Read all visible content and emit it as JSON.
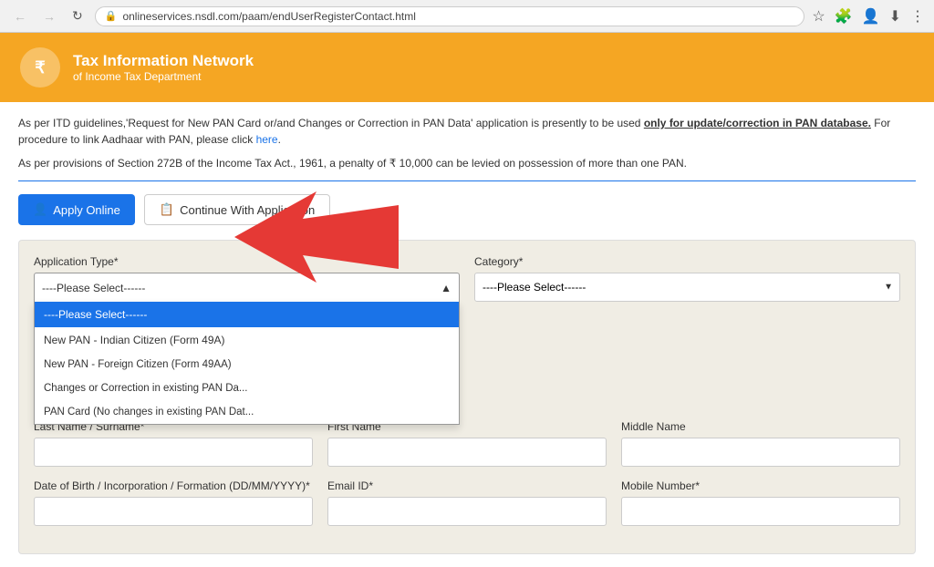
{
  "browser": {
    "url": "onlineservices.nsdl.com/paam/endUserRegisterContact.html",
    "back_disabled": true,
    "forward_disabled": true
  },
  "header": {
    "title_line1": "Tax Information Network",
    "title_line2": "of Income Tax Department"
  },
  "notice": {
    "line1_before": "As per ITD guidelines,'Request for New PAN Card or/and Changes or Correction in PAN Data' application is presently to be used ",
    "line1_underline": "only for update/correction in PAN database.",
    "line1_after": " For procedure to link Aadhaar with PAN, please click ",
    "line1_link": "here",
    "line2": "As per provisions of Section 272B of the Income Tax Act., 1961, a penalty of ₹ 10,000 can be levied on possession of more than one PAN."
  },
  "buttons": {
    "apply_label": "Apply Online",
    "continue_label": "Continue With Application"
  },
  "form": {
    "application_type_label": "Application Type*",
    "application_type_placeholder": "----Please Select------",
    "category_label": "Category*",
    "category_placeholder": "----Please Select------",
    "dropdown_items": [
      {
        "id": "please_select",
        "label": "----Please Select------",
        "selected": true
      },
      {
        "id": "new_pan_indian",
        "label": "New PAN - Indian Citizen (Form 49A)"
      },
      {
        "id": "new_pan_foreign",
        "label": "New PAN - Foreign Citizen (Form 49AA)"
      },
      {
        "id": "changes_correction",
        "label": "Changes or Correction in existing PAN Da..."
      },
      {
        "id": "reprint",
        "label": "PAN Card (No changes in existing PAN Dat..."
      }
    ],
    "last_name_label": "Last Name / Surname*",
    "first_name_label": "First Name",
    "middle_name_label": "Middle Name",
    "dob_label": "Date of Birth / Incorporation / Formation (DD/MM/YYYY)*",
    "email_label": "Email ID*",
    "mobile_label": "Mobile Number*"
  }
}
